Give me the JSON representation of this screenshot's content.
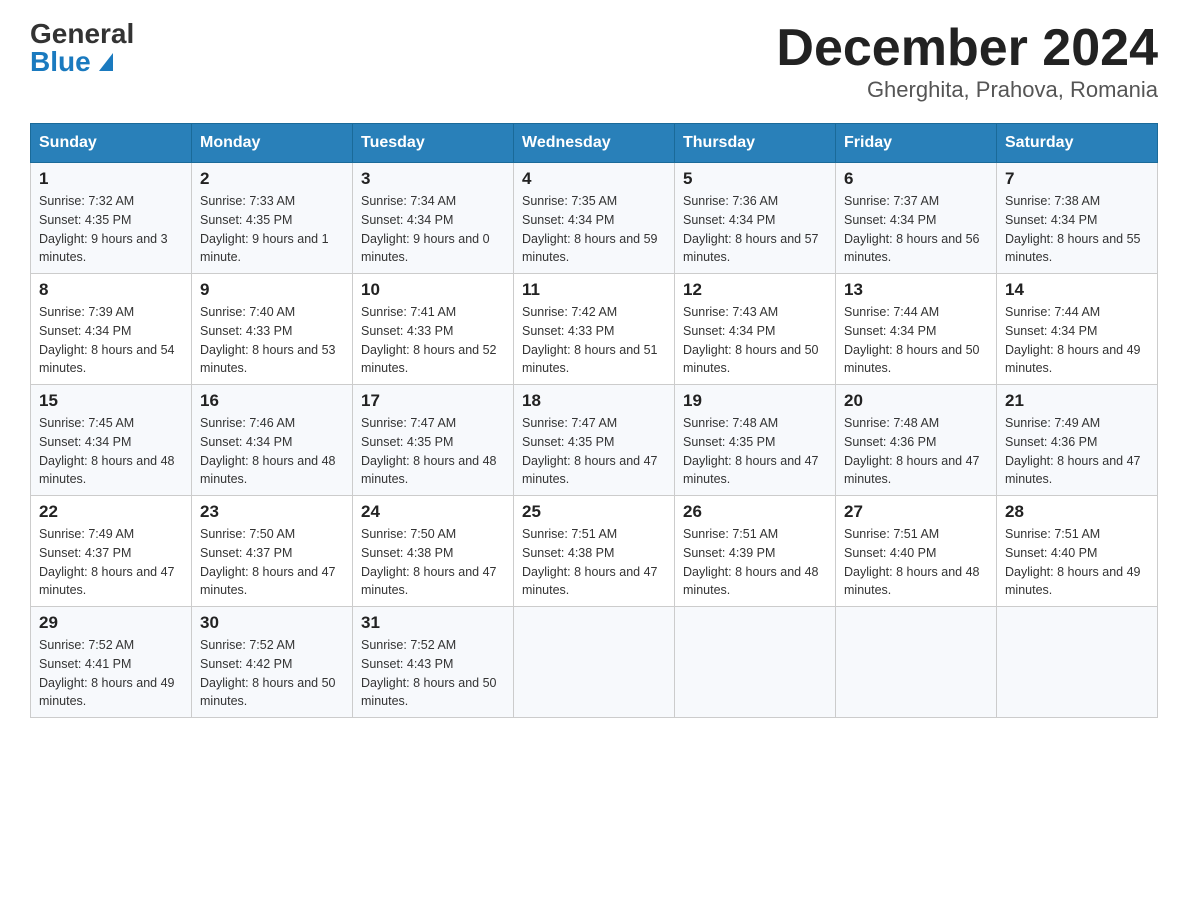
{
  "logo": {
    "general": "General",
    "blue": "Blue"
  },
  "title": "December 2024",
  "subtitle": "Gherghita, Prahova, Romania",
  "days_of_week": [
    "Sunday",
    "Monday",
    "Tuesday",
    "Wednesday",
    "Thursday",
    "Friday",
    "Saturday"
  ],
  "weeks": [
    [
      {
        "day": "1",
        "sunrise": "7:32 AM",
        "sunset": "4:35 PM",
        "daylight": "9 hours and 3 minutes."
      },
      {
        "day": "2",
        "sunrise": "7:33 AM",
        "sunset": "4:35 PM",
        "daylight": "9 hours and 1 minute."
      },
      {
        "day": "3",
        "sunrise": "7:34 AM",
        "sunset": "4:34 PM",
        "daylight": "9 hours and 0 minutes."
      },
      {
        "day": "4",
        "sunrise": "7:35 AM",
        "sunset": "4:34 PM",
        "daylight": "8 hours and 59 minutes."
      },
      {
        "day": "5",
        "sunrise": "7:36 AM",
        "sunset": "4:34 PM",
        "daylight": "8 hours and 57 minutes."
      },
      {
        "day": "6",
        "sunrise": "7:37 AM",
        "sunset": "4:34 PM",
        "daylight": "8 hours and 56 minutes."
      },
      {
        "day": "7",
        "sunrise": "7:38 AM",
        "sunset": "4:34 PM",
        "daylight": "8 hours and 55 minutes."
      }
    ],
    [
      {
        "day": "8",
        "sunrise": "7:39 AM",
        "sunset": "4:34 PM",
        "daylight": "8 hours and 54 minutes."
      },
      {
        "day": "9",
        "sunrise": "7:40 AM",
        "sunset": "4:33 PM",
        "daylight": "8 hours and 53 minutes."
      },
      {
        "day": "10",
        "sunrise": "7:41 AM",
        "sunset": "4:33 PM",
        "daylight": "8 hours and 52 minutes."
      },
      {
        "day": "11",
        "sunrise": "7:42 AM",
        "sunset": "4:33 PM",
        "daylight": "8 hours and 51 minutes."
      },
      {
        "day": "12",
        "sunrise": "7:43 AM",
        "sunset": "4:34 PM",
        "daylight": "8 hours and 50 minutes."
      },
      {
        "day": "13",
        "sunrise": "7:44 AM",
        "sunset": "4:34 PM",
        "daylight": "8 hours and 50 minutes."
      },
      {
        "day": "14",
        "sunrise": "7:44 AM",
        "sunset": "4:34 PM",
        "daylight": "8 hours and 49 minutes."
      }
    ],
    [
      {
        "day": "15",
        "sunrise": "7:45 AM",
        "sunset": "4:34 PM",
        "daylight": "8 hours and 48 minutes."
      },
      {
        "day": "16",
        "sunrise": "7:46 AM",
        "sunset": "4:34 PM",
        "daylight": "8 hours and 48 minutes."
      },
      {
        "day": "17",
        "sunrise": "7:47 AM",
        "sunset": "4:35 PM",
        "daylight": "8 hours and 48 minutes."
      },
      {
        "day": "18",
        "sunrise": "7:47 AM",
        "sunset": "4:35 PM",
        "daylight": "8 hours and 47 minutes."
      },
      {
        "day": "19",
        "sunrise": "7:48 AM",
        "sunset": "4:35 PM",
        "daylight": "8 hours and 47 minutes."
      },
      {
        "day": "20",
        "sunrise": "7:48 AM",
        "sunset": "4:36 PM",
        "daylight": "8 hours and 47 minutes."
      },
      {
        "day": "21",
        "sunrise": "7:49 AM",
        "sunset": "4:36 PM",
        "daylight": "8 hours and 47 minutes."
      }
    ],
    [
      {
        "day": "22",
        "sunrise": "7:49 AM",
        "sunset": "4:37 PM",
        "daylight": "8 hours and 47 minutes."
      },
      {
        "day": "23",
        "sunrise": "7:50 AM",
        "sunset": "4:37 PM",
        "daylight": "8 hours and 47 minutes."
      },
      {
        "day": "24",
        "sunrise": "7:50 AM",
        "sunset": "4:38 PM",
        "daylight": "8 hours and 47 minutes."
      },
      {
        "day": "25",
        "sunrise": "7:51 AM",
        "sunset": "4:38 PM",
        "daylight": "8 hours and 47 minutes."
      },
      {
        "day": "26",
        "sunrise": "7:51 AM",
        "sunset": "4:39 PM",
        "daylight": "8 hours and 48 minutes."
      },
      {
        "day": "27",
        "sunrise": "7:51 AM",
        "sunset": "4:40 PM",
        "daylight": "8 hours and 48 minutes."
      },
      {
        "day": "28",
        "sunrise": "7:51 AM",
        "sunset": "4:40 PM",
        "daylight": "8 hours and 49 minutes."
      }
    ],
    [
      {
        "day": "29",
        "sunrise": "7:52 AM",
        "sunset": "4:41 PM",
        "daylight": "8 hours and 49 minutes."
      },
      {
        "day": "30",
        "sunrise": "7:52 AM",
        "sunset": "4:42 PM",
        "daylight": "8 hours and 50 minutes."
      },
      {
        "day": "31",
        "sunrise": "7:52 AM",
        "sunset": "4:43 PM",
        "daylight": "8 hours and 50 minutes."
      },
      null,
      null,
      null,
      null
    ]
  ]
}
